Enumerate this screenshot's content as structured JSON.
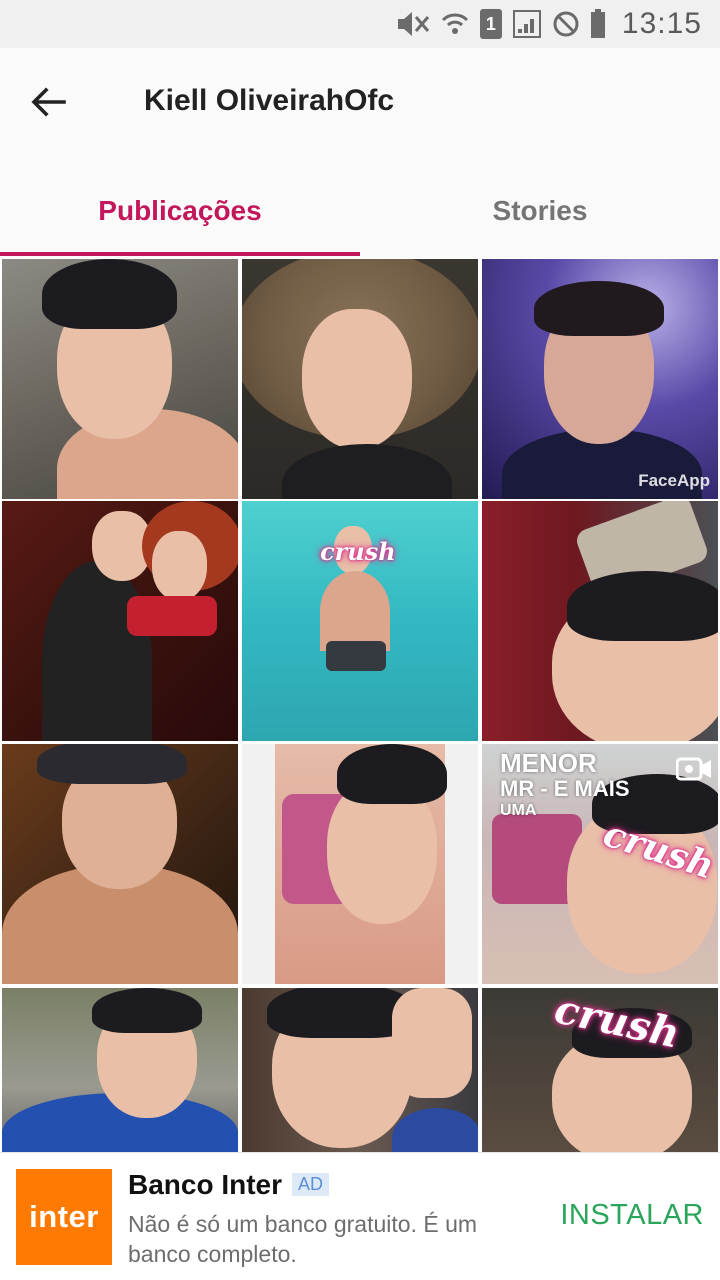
{
  "status_bar": {
    "time": "13:15",
    "sim_slot": "1"
  },
  "header": {
    "title": "Kiell OliveirahOfc",
    "back_icon": "arrow-left-icon"
  },
  "tabs": [
    {
      "label": "Publicações",
      "active": true
    },
    {
      "label": "Stories",
      "active": false
    }
  ],
  "grid": {
    "cells": [
      {
        "name": "post-1",
        "overlay": ""
      },
      {
        "name": "post-2",
        "overlay": ""
      },
      {
        "name": "post-3",
        "overlay": "FaceApp"
      },
      {
        "name": "post-4",
        "overlay": ""
      },
      {
        "name": "post-5",
        "overlay": "crush"
      },
      {
        "name": "post-6",
        "overlay": ""
      },
      {
        "name": "post-7",
        "overlay": ""
      },
      {
        "name": "post-8",
        "overlay": ""
      },
      {
        "name": "post-9",
        "overlay": "crush",
        "story_lines": [
          "MENOR",
          "MR - E MAIS",
          "UMA"
        ]
      },
      {
        "name": "post-10",
        "overlay": ""
      },
      {
        "name": "post-11",
        "overlay": ""
      },
      {
        "name": "post-12",
        "overlay": "crush"
      }
    ]
  },
  "ad": {
    "logo_text": "inter",
    "advertiser": "Banco Inter",
    "badge": "AD",
    "description": "Não é só um banco gratuito. É um banco completo.",
    "cta": "INSTALAR"
  },
  "colors": {
    "accent": "#c2185b",
    "install": "#2aa55a",
    "ad_logo_bg": "#ff7a00"
  }
}
